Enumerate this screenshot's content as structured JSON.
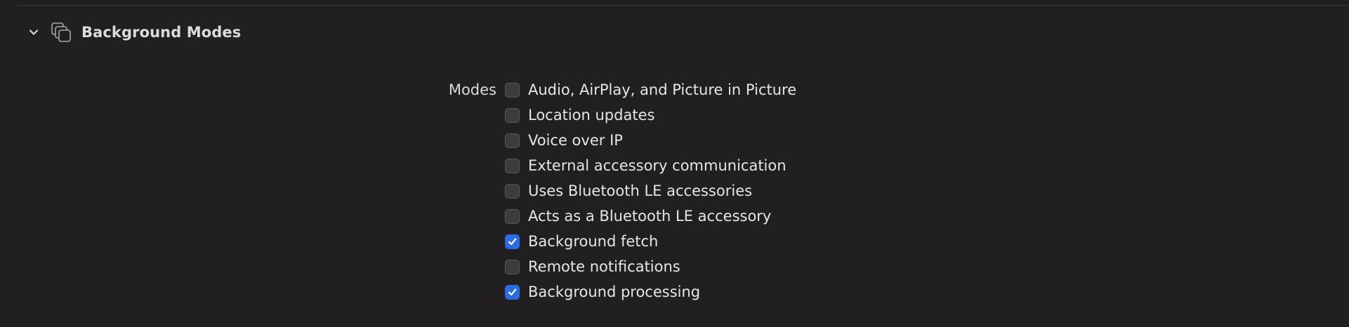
{
  "section": {
    "title": "Background Modes",
    "expanded": true,
    "chevron_icon": "chevron-down-icon",
    "section_icon": "stacked-windows-icon"
  },
  "modes": {
    "label": "Modes",
    "items": [
      {
        "label": "Audio, AirPlay, and Picture in Picture",
        "checked": false
      },
      {
        "label": "Location updates",
        "checked": false
      },
      {
        "label": "Voice over IP",
        "checked": false
      },
      {
        "label": "External accessory communication",
        "checked": false
      },
      {
        "label": "Uses Bluetooth LE accessories",
        "checked": false
      },
      {
        "label": "Acts as a Bluetooth LE accessory",
        "checked": false
      },
      {
        "label": "Background fetch",
        "checked": true
      },
      {
        "label": "Remote notifications",
        "checked": false
      },
      {
        "label": "Background processing",
        "checked": true
      }
    ]
  },
  "colors": {
    "background": "#221f22",
    "checkbox_checked": "#2d6be0",
    "checkbox_unchecked": "#3e3b3e",
    "text": "#e6e6e6"
  }
}
